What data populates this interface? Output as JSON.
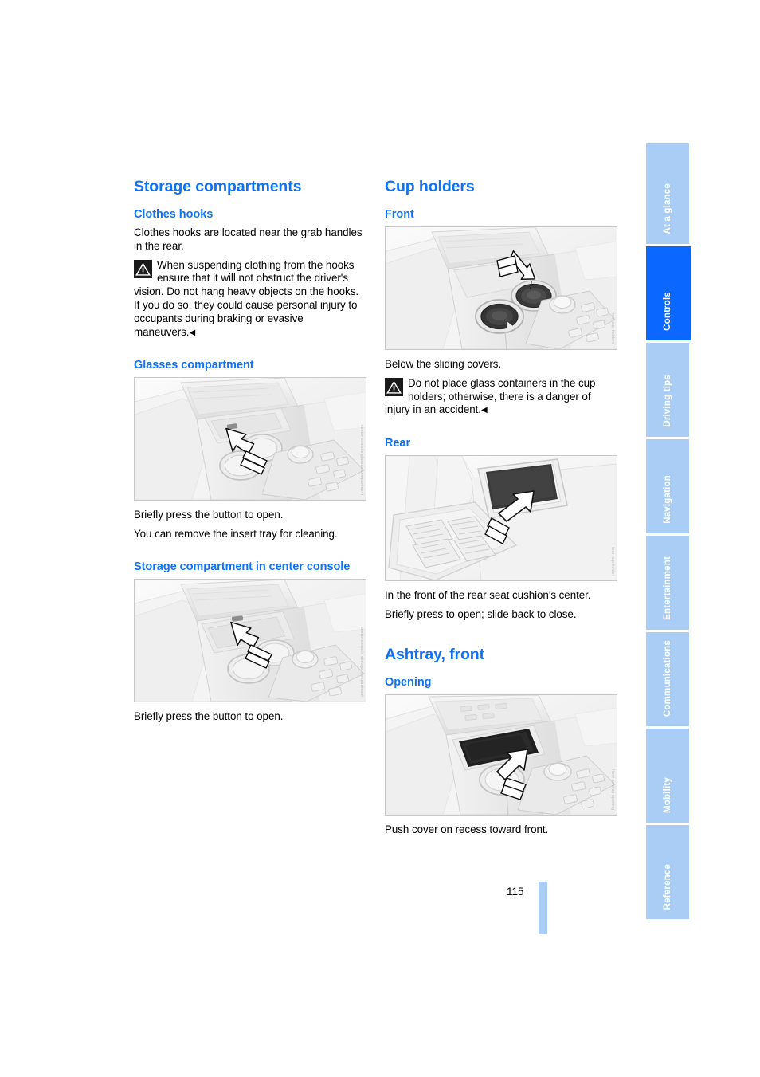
{
  "document": {
    "page_number": "115"
  },
  "left_column": {
    "section_title": "Storage compartments",
    "clothes_hooks": {
      "heading": "Clothes hooks",
      "paragraph": "Clothes hooks are located near the grab handles in the rear.",
      "warning": "When suspending clothing from the hooks ensure that it will not obstruct the driver's vision. Do not hang heavy objects on the hooks. If you do so, they could cause personal injury to occupants during braking or evasive maneuvers.",
      "warning_end_marker": "◀"
    },
    "glasses_compartment": {
      "heading": "Glasses compartment",
      "figure_credit": "center console glasses compartment",
      "paragraph_1": "Briefly press the button to open.",
      "paragraph_2": "You can remove the insert tray for cleaning."
    },
    "storage_center_console": {
      "heading": "Storage compartment in center console",
      "figure_credit": "center console storage compartment",
      "paragraph_1": "Briefly press the button to open."
    }
  },
  "right_column": {
    "section_title": "Cup holders",
    "front": {
      "heading": "Front",
      "figure_credit": "front cup holders",
      "paragraph_1": "Below the sliding covers.",
      "warning": "Do not place glass containers in the cup holders; otherwise, there is a danger of injury in an accident.",
      "warning_end_marker": "◀"
    },
    "rear": {
      "heading": "Rear",
      "figure_credit": "rear cup holder",
      "paragraph_1": "In the front of the rear seat cushion's center.",
      "paragraph_2": "Briefly press to open; slide back to close."
    },
    "ashtray": {
      "section_title": "Ashtray, front",
      "heading": "Opening",
      "figure_credit": "front ashtray opening",
      "paragraph_1": "Push cover on recess toward front."
    }
  },
  "sidebar": {
    "tabs": [
      {
        "label": "At a glance",
        "active": false
      },
      {
        "label": "Controls",
        "active": true
      },
      {
        "label": "Driving tips",
        "active": false
      },
      {
        "label": "Navigation",
        "active": false
      },
      {
        "label": "Entertainment",
        "active": false
      },
      {
        "label": "Communications",
        "active": false
      },
      {
        "label": "Mobility",
        "active": false
      },
      {
        "label": "Reference",
        "active": false
      }
    ]
  },
  "colors": {
    "heading_blue": "#0f72f5",
    "tab_inactive": "#a9cdf4",
    "tab_active": "#0a67ff",
    "page_bar": "#a9cdf4"
  }
}
